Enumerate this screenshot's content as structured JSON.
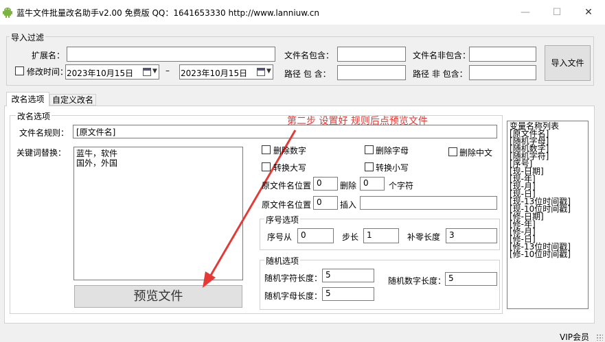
{
  "window": {
    "title": "蓝牛文件批量改名助手v2.00 免费版 QQ：1641653330  http://www.lanniuw.cn",
    "minimize": "—",
    "maximize": "☐",
    "close": "✕"
  },
  "import_filter": {
    "legend": "导入过滤",
    "ext_label": "扩展名：",
    "ext_value": "",
    "name_contains_label": "文件名包含：",
    "name_contains_value": "",
    "name_not_contains_label": "文件名非包含：",
    "name_not_contains_value": "",
    "modtime_label": "修改时间：",
    "modtime_checked": false,
    "date_from": "2023年10月15日",
    "date_sep": "–",
    "date_to": "2023年10月15日",
    "path_contains_label": "路径 包 含：",
    "path_contains_value": "",
    "path_not_contains_label": "路径 非 包含：",
    "path_not_contains_value": "",
    "import_button": "导入文件"
  },
  "tabs": [
    {
      "label": "改名选项",
      "active": true
    },
    {
      "label": "自定义改名",
      "active": false
    }
  ],
  "rename": {
    "legend": "改名选项",
    "rule_label": "文件名规则：",
    "rule_value": "[原文件名]",
    "keyword_label": "关键词替换：",
    "keyword_value": "蓝牛，软件\n国外，外国",
    "annotation": "第二步 设置好 规则后点预览文件",
    "preview_button": "预览文件",
    "delete_digits": "删除数字",
    "delete_letters": "删除字母",
    "delete_chinese": "删除中文",
    "to_upper": "转换大写",
    "to_lower": "转换小写",
    "pos1_label": "原文件名位置",
    "pos1_value": "0",
    "delete_label": "删除",
    "delete_count": "0",
    "chars_label": "个字符",
    "pos2_label": "原文件名位置",
    "pos2_value": "0",
    "insert_label": "插入",
    "insert_value": "",
    "seq": {
      "legend": "序号选项",
      "from_label": "序号从",
      "from_value": "0",
      "step_label": "步长",
      "step_value": "1",
      "pad_label": "补零长度",
      "pad_value": "3"
    },
    "random": {
      "legend": "随机选项",
      "char_len_label": "随机字符长度：",
      "char_len_value": "5",
      "num_len_label": "随机数字长度：",
      "num_len_value": "5",
      "letter_len_label": "随机字母长度：",
      "letter_len_value": "5"
    },
    "var_list_title": "变量名称列表",
    "var_list": [
      "[原文件名]",
      "[随机字母]",
      "[随机数字]",
      "[随机字符]",
      "[序号]",
      "[现-日期]",
      "[现-年]",
      "[现-月]",
      "[现-日]",
      "[现-13位时间戳]",
      "[现-10位时间戳]",
      "[修-日期]",
      "[修-年]",
      "[修-月]",
      "[修-日]",
      "[修-13位时间戳]",
      "[修-10位时间戳]"
    ]
  },
  "status": {
    "vip": "VIP会员"
  }
}
